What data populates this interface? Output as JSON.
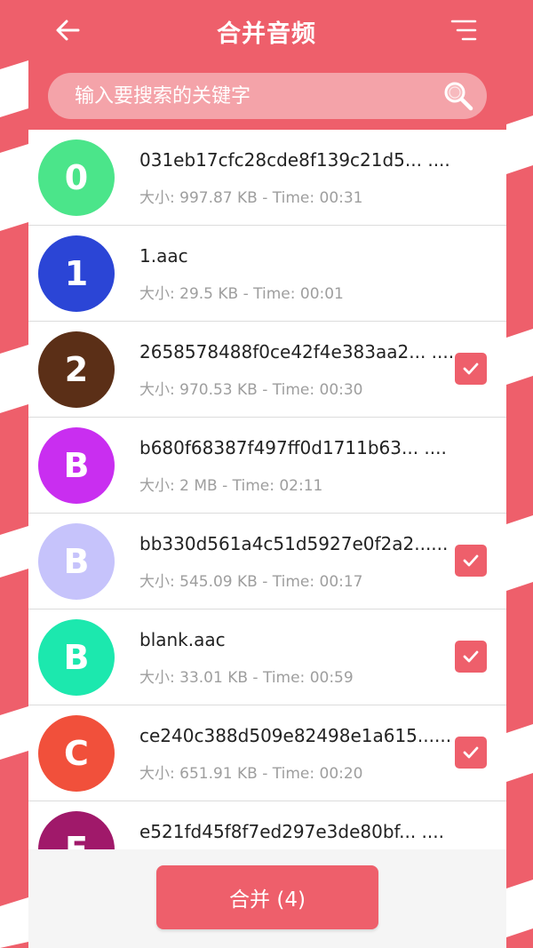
{
  "header": {
    "title": "合并音频",
    "back_icon": "arrow-left-icon",
    "menu_icon": "sort-lines-icon"
  },
  "search": {
    "placeholder": "输入要搜索的关键字",
    "icon": "search-icon"
  },
  "files": [
    {
      "initial": "0",
      "color": "#4be58a",
      "name": "031eb17cfc28cde8f139c21d5... ....",
      "meta": "大小: 997.87 KB - Time: 00:31",
      "checked": false
    },
    {
      "initial": "1",
      "color": "#2b45d6",
      "name": "1.aac",
      "meta": "大小: 29.5 KB - Time: 00:01",
      "checked": false
    },
    {
      "initial": "2",
      "color": "#5b2f17",
      "name": "2658578488f0ce42f4e383aa2... ....",
      "meta": "大小: 970.53 KB - Time: 00:30",
      "checked": true
    },
    {
      "initial": "B",
      "color": "#c92ef0",
      "name": "b680f68387f497ff0d1711b63... ....",
      "meta": "大小: 2 MB - Time: 02:11",
      "checked": false
    },
    {
      "initial": "B",
      "color": "#c6c3fb",
      "name": "bb330d561a4c51d5927e0f2a2......",
      "meta": "大小: 545.09 KB - Time: 00:17",
      "checked": true
    },
    {
      "initial": "B",
      "color": "#1ce8ae",
      "name": "blank.aac",
      "meta": "大小: 33.01 KB - Time: 00:59",
      "checked": true
    },
    {
      "initial": "C",
      "color": "#f1503b",
      "name": "ce240c388d509e82498e1a615......",
      "meta": "大小: 651.91 KB - Time: 00:20",
      "checked": true
    },
    {
      "initial": "E",
      "color": "#a0196a",
      "name": "e521fd45f8f7ed297e3de80bf... ....",
      "meta": "",
      "checked": false
    }
  ],
  "footer": {
    "merge_label": "合并 (4)"
  },
  "colors": {
    "accent": "#ee5f6b",
    "search_bg": "#f4a3a9",
    "stripe": "#ffffff"
  }
}
